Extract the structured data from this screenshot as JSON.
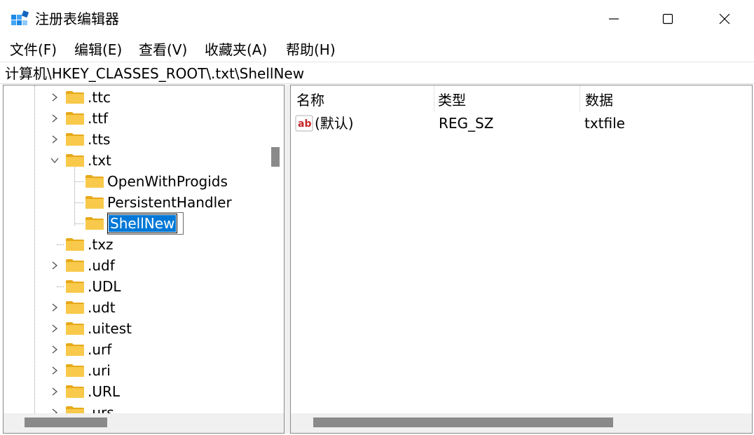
{
  "window": {
    "title": "注册表编辑器",
    "icon": "regedit-icon"
  },
  "menu": [
    "文件(F)",
    "编辑(E)",
    "查看(V)",
    "收藏夹(A)",
    "帮助(H)"
  ],
  "address": "计算机\\HKEY_CLASSES_ROOT\\.txt\\ShellNew",
  "tree": {
    "nodes": [
      {
        "label": ".ttc",
        "level": 1,
        "expander": "collapsed"
      },
      {
        "label": ".ttf",
        "level": 1,
        "expander": "collapsed"
      },
      {
        "label": ".tts",
        "level": 1,
        "expander": "collapsed"
      },
      {
        "label": ".txt",
        "level": 1,
        "expander": "expanded"
      },
      {
        "label": "OpenWithProgids",
        "level": 2,
        "expander": "none"
      },
      {
        "label": "PersistentHandler",
        "level": 2,
        "expander": "none"
      },
      {
        "label": "ShellNew",
        "level": 2,
        "expander": "none",
        "selected": true,
        "editing": true
      },
      {
        "label": ".txz",
        "level": 1,
        "expander": "none"
      },
      {
        "label": ".udf",
        "level": 1,
        "expander": "collapsed"
      },
      {
        "label": ".UDL",
        "level": 1,
        "expander": "none"
      },
      {
        "label": ".udt",
        "level": 1,
        "expander": "collapsed"
      },
      {
        "label": ".uitest",
        "level": 1,
        "expander": "collapsed"
      },
      {
        "label": ".urf",
        "level": 1,
        "expander": "collapsed"
      },
      {
        "label": ".uri",
        "level": 1,
        "expander": "collapsed"
      },
      {
        "label": ".URL",
        "level": 1,
        "expander": "collapsed"
      },
      {
        "label": ".urs",
        "level": 1,
        "expander": "collapsed"
      }
    ]
  },
  "list": {
    "columns": [
      "名称",
      "类型",
      "数据"
    ],
    "rows": [
      {
        "icon": "reg-string-icon",
        "name": "(默认)",
        "type": "REG_SZ",
        "data": "txtfile"
      }
    ]
  },
  "colors": {
    "selection": "#0078d7",
    "folder": "#f8c94a",
    "folder_dark": "#e6a918"
  }
}
